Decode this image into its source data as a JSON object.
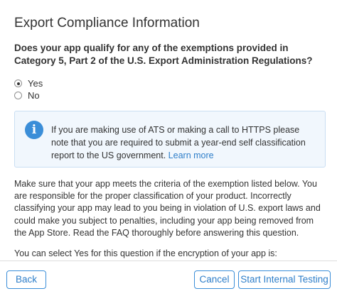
{
  "dialog": {
    "title": "Export Compliance Information",
    "question": "Does your app qualify for any of the exemptions provided in Category 5, Part 2 of the U.S. Export Administration Regulations?",
    "options": [
      {
        "label": "Yes",
        "selected": true
      },
      {
        "label": "No",
        "selected": false
      }
    ],
    "info": {
      "icon": "info-icon",
      "text": "If you are making use of ATS or making a call to HTTPS please note that you are required to submit a year-end self classification report to the US government. ",
      "link_text": "Learn more"
    },
    "paragraph": "Make sure that your app meets the criteria of the exemption listed below. You are responsible for the proper classification of your product. Incorrectly classifying your app may lead to you being in violation of U.S. export laws and could make you subject to penalties, including your app being removed from the App Store. Read the FAQ thoroughly before answering this question.",
    "paragraph2": "You can select Yes for this question if the encryption of your app is:"
  },
  "footer": {
    "back_label": "Back",
    "cancel_label": "Cancel",
    "start_label": "Start Internal Testing"
  },
  "colors": {
    "accent": "#2e7ec9",
    "info_background": "#f1f7fd",
    "info_border": "#c9def3",
    "text": "#333333"
  }
}
